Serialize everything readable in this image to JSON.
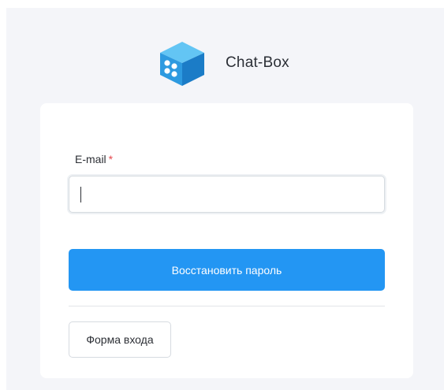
{
  "brand": {
    "name": "Chat-Box",
    "logo_icon": "cube-logo-icon",
    "colors": {
      "top": "#5cc0f2",
      "left": "#2a95dd",
      "right": "#1c78c4"
    }
  },
  "form": {
    "email_label": "E-mail",
    "required_marker": "*",
    "email_value": "",
    "email_placeholder": "",
    "submit_label": "Восстановить пароль",
    "login_link_label": "Форма входа"
  },
  "colors": {
    "accent": "#2396f3",
    "required": "#e5484d",
    "background": "#f4f5f9"
  }
}
